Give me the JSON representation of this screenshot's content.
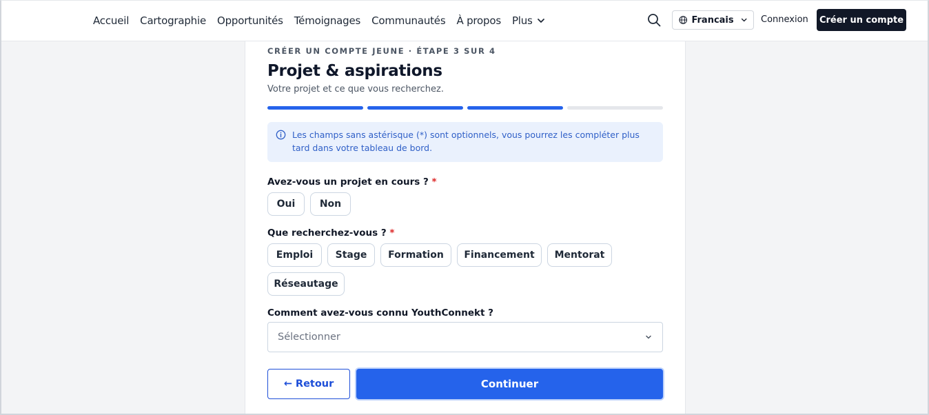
{
  "header": {
    "nav": [
      {
        "label": "Accueil"
      },
      {
        "label": "Cartographie"
      },
      {
        "label": "Opportunités"
      },
      {
        "label": "Témoignages"
      },
      {
        "label": "Communautés"
      },
      {
        "label": "À propos"
      }
    ],
    "more_label": "Plus",
    "language_label": "Francais",
    "login_label": "Connexion",
    "signup_label": "Créer un compte",
    "icons": {
      "search": "search-icon",
      "globe": "globe-icon",
      "chevron": "chevron-down-icon"
    }
  },
  "form": {
    "eyebrow": "CRÉER UN COMPTE JEUNE · ÉTAPE 3 SUR 4",
    "title": "Projet & aspirations",
    "subtitle": "Votre projet et ce que vous recherchez.",
    "progress": {
      "current_step": 3,
      "total_steps": 4
    },
    "info_text": "Les champs sans astérisque (*) sont optionnels, vous pourrez les compléter plus tard dans votre tableau de bord.",
    "q1": {
      "label": "Avez-vous un projet en cours ?",
      "required_mark": "*",
      "options": [
        "Oui",
        "Non"
      ]
    },
    "q2": {
      "label": "Que recherchez-vous ?",
      "required_mark": "*",
      "options": [
        "Emploi",
        "Stage",
        "Formation",
        "Financement",
        "Mentorat",
        "Réseautage"
      ]
    },
    "q3": {
      "label": "Comment avez-vous connu YouthConnekt ?",
      "placeholder": "Sélectionner"
    },
    "back_label": "← Retour",
    "continue_label": "Continuer"
  },
  "colors": {
    "accent": "#2563eb",
    "dark": "#111827",
    "required": "#dc2626",
    "info_bg": "#eaf1fd"
  }
}
